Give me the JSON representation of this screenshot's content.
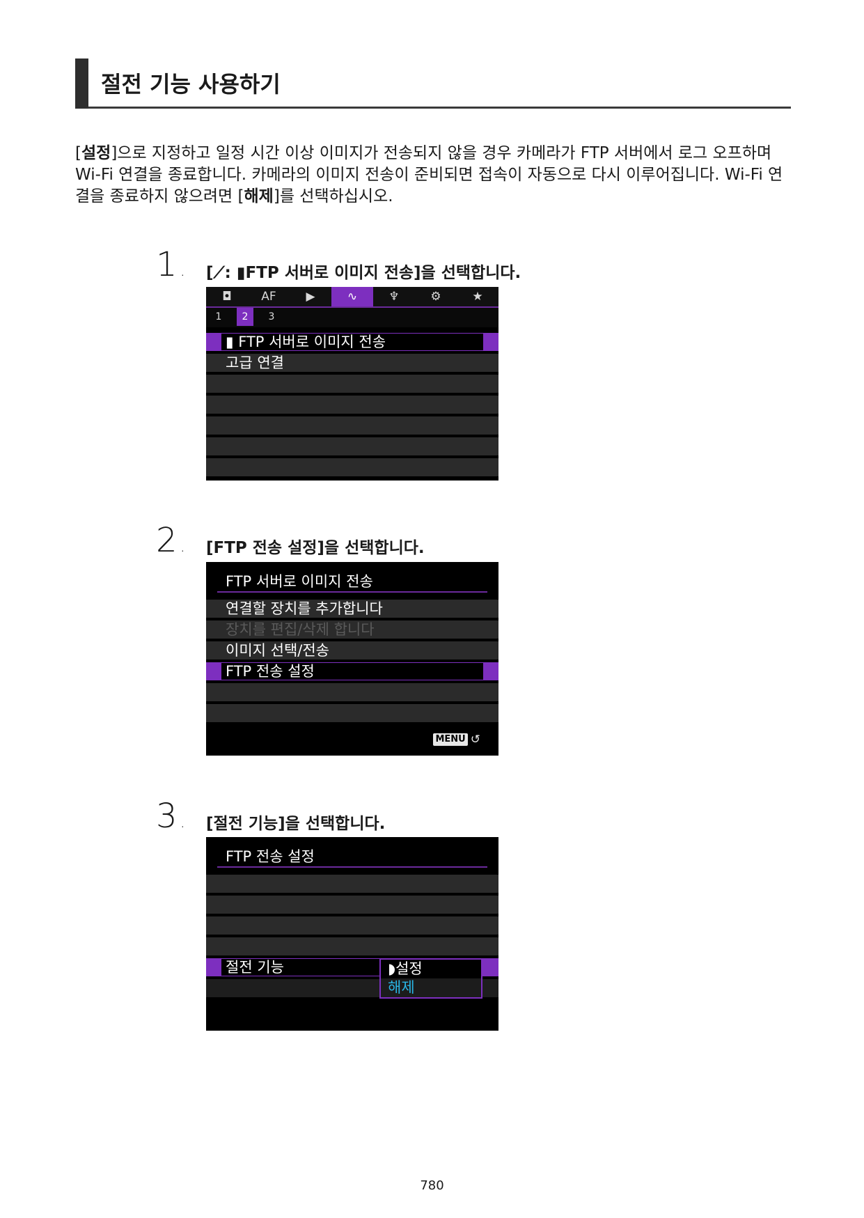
{
  "heading": {
    "title": "절전 기능 사용하기"
  },
  "intro": {
    "p1_open": "[",
    "p1_bold": "설정",
    "p1_rest": "]으로 지정하고 일정 시간 이상 이미지가 전송되지 않을 경우 카메라가 FTP 서버에서 로그 오프하며 Wi-Fi 연결을 종료합니다. 카메라의 이미지 전송이 준비되면 접속이 자동으로 다시 이루어집니다. Wi-Fi 연결을 종료하지 않으려면 [",
    "p1_bold2": "해제",
    "p1_end": "]를 선택하십시오."
  },
  "steps": [
    {
      "num": "1",
      "text": "[⟋: ▮FTP 서버로 이미지 전송]을 선택합니다."
    },
    {
      "num": "2",
      "text": "[FTP 전송 설정]을 선택합니다."
    },
    {
      "num": "3",
      "text": "[절전 기능]을 선택합니다."
    }
  ],
  "screen1": {
    "tabs": [
      "◘",
      "AF",
      "▶",
      "∿",
      "♆",
      "⚙",
      "★"
    ],
    "subtabs": [
      "1",
      "2",
      "3"
    ],
    "items": [
      "▮ FTP 서버로 이미지 전송",
      "고급 연결"
    ]
  },
  "screen2": {
    "title": "FTP 서버로 이미지 전송",
    "items": [
      "연결할 장치를 추가합니다",
      "장치를 편집/삭제 합니다",
      "이미지 선택/전송",
      "FTP 전송 설정"
    ],
    "menu_label": "MENU",
    "return_icon": "↺"
  },
  "screen3": {
    "title": "FTP 전송 설정",
    "item": "절전 기능",
    "options": [
      "◗설정",
      "해제"
    ]
  },
  "page_number": "780",
  "colors": {
    "accent": "#7d2fbf",
    "alt_option": "#29b6e6"
  }
}
